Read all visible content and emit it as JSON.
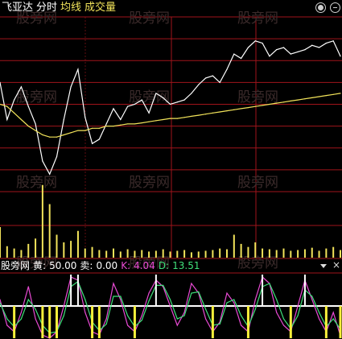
{
  "header": {
    "app_name": "飞亚达",
    "tab_time": "分时",
    "avg_label": "均线",
    "vol_label": "成交量"
  },
  "sub_panel": {
    "title": "股旁网",
    "yellow_label": "黄:",
    "yellow_value": "50.00",
    "sell_label": "卖:",
    "sell_value": "0.00",
    "k_label": "K:",
    "k_value": "4.04",
    "d_label": "D:",
    "d_value": "13.51"
  },
  "watermark": "股旁网",
  "colors": {
    "price": "#ffffff",
    "avg": "#f2e35a",
    "volume": "#f2e35a",
    "grid": "#a0141b",
    "k_line": "#e94ad4",
    "d_line": "#3fe07a",
    "signal": "#ffffff",
    "bar": "#f7ef3a"
  },
  "chart_data": [
    {
      "type": "line",
      "title": "",
      "x": [
        0,
        5,
        10,
        15,
        20,
        25,
        30,
        35,
        40,
        45,
        50,
        55,
        60,
        65,
        70,
        75,
        80,
        85,
        90,
        95,
        100,
        105,
        110,
        115,
        120,
        125,
        130,
        135,
        140,
        145,
        150,
        155,
        160,
        165,
        170,
        175,
        180,
        185,
        190,
        195,
        200,
        205,
        210,
        215,
        220,
        225,
        230,
        235,
        240
      ],
      "series": [
        {
          "name": "price",
          "values": [
            2.0,
            0.3,
            1.2,
            1.8,
            0.9,
            0.1,
            -1.6,
            -2.2,
            -1.4,
            0.3,
            1.8,
            2.6,
            0.4,
            -0.8,
            -0.6,
            0.1,
            0.8,
            0.3,
            0.9,
            1.0,
            1.2,
            0.6,
            1.5,
            1.3,
            1.0,
            1.1,
            1.2,
            1.5,
            1.9,
            2.2,
            2.3,
            2.0,
            2.6,
            3.3,
            3.1,
            3.6,
            3.9,
            3.8,
            3.2,
            3.5,
            3.6,
            3.3,
            3.4,
            3.5,
            3.7,
            3.6,
            3.8,
            3.9,
            3.2
          ]
        },
        {
          "name": "avg",
          "values": [
            1.0,
            0.9,
            0.6,
            0.3,
            0.0,
            -0.2,
            -0.4,
            -0.5,
            -0.5,
            -0.4,
            -0.3,
            -0.2,
            -0.2,
            -0.1,
            -0.1,
            0.0,
            0.0,
            0.05,
            0.1,
            0.1,
            0.15,
            0.2,
            0.25,
            0.3,
            0.35,
            0.35,
            0.4,
            0.45,
            0.5,
            0.55,
            0.6,
            0.65,
            0.7,
            0.75,
            0.8,
            0.85,
            0.9,
            0.95,
            1.0,
            1.05,
            1.1,
            1.15,
            1.2,
            1.25,
            1.3,
            1.35,
            1.4,
            1.45,
            1.5
          ]
        }
      ]
    },
    {
      "type": "bar",
      "title": "",
      "x": [
        0,
        5,
        10,
        15,
        20,
        25,
        30,
        35,
        40,
        45,
        50,
        55,
        60,
        65,
        70,
        75,
        80,
        85,
        90,
        95,
        100,
        105,
        110,
        115,
        120,
        125,
        130,
        135,
        140,
        145,
        150,
        155,
        160,
        165,
        170,
        175,
        180,
        185,
        190,
        195,
        200,
        205,
        210,
        215,
        220,
        225,
        230,
        235,
        240
      ],
      "series": [
        {
          "name": "volume",
          "values": [
            40,
            15,
            12,
            10,
            18,
            25,
            95,
            70,
            30,
            20,
            22,
            35,
            12,
            14,
            10,
            9,
            12,
            8,
            11,
            9,
            10,
            8,
            9,
            11,
            8,
            9,
            10,
            7,
            8,
            9,
            10,
            12,
            11,
            30,
            18,
            14,
            20,
            12,
            11,
            10,
            12,
            9,
            10,
            11,
            13,
            9,
            12,
            14,
            10
          ]
        }
      ]
    },
    {
      "type": "line",
      "title": "",
      "x": [
        0,
        5,
        10,
        15,
        20,
        25,
        30,
        35,
        40,
        45,
        50,
        55,
        60,
        65,
        70,
        75,
        80,
        85,
        90,
        95,
        100,
        105,
        110,
        115,
        120,
        125,
        130,
        135,
        140,
        145,
        150,
        155,
        160,
        165,
        170,
        175,
        180,
        185,
        190,
        195,
        200,
        205,
        210,
        215,
        220,
        225,
        230,
        235,
        240
      ],
      "series": [
        {
          "name": "K",
          "values": [
            60,
            20,
            10,
            40,
            80,
            30,
            5,
            0,
            10,
            50,
            95,
            90,
            40,
            10,
            5,
            30,
            85,
            60,
            20,
            10,
            35,
            70,
            90,
            80,
            50,
            20,
            40,
            85,
            70,
            30,
            10,
            25,
            70,
            55,
            20,
            10,
            60,
            95,
            85,
            40,
            20,
            10,
            50,
            90,
            60,
            30,
            10,
            40,
            4
          ]
        },
        {
          "name": "D",
          "values": [
            55,
            30,
            18,
            30,
            60,
            45,
            20,
            8,
            10,
            35,
            80,
            88,
            60,
            25,
            12,
            22,
            65,
            65,
            35,
            18,
            28,
            58,
            82,
            82,
            60,
            30,
            35,
            70,
            72,
            45,
            20,
            22,
            55,
            60,
            35,
            18,
            45,
            80,
            85,
            60,
            30,
            15,
            35,
            75,
            65,
            40,
            18,
            30,
            14
          ]
        }
      ],
      "ylim": [
        0,
        100
      ]
    }
  ]
}
